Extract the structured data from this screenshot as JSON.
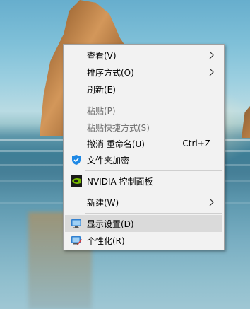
{
  "context_menu": {
    "items": [
      {
        "label": "查看(V)"
      },
      {
        "label": "排序方式(O)"
      },
      {
        "label": "刷新(E)"
      },
      {
        "label": "粘贴(P)"
      },
      {
        "label": "粘贴快捷方式(S)"
      },
      {
        "label": "撤消 重命名(U)",
        "shortcut": "Ctrl+Z"
      },
      {
        "label": "文件夹加密"
      },
      {
        "label": "NVIDIA 控制面板"
      },
      {
        "label": "新建(W)"
      },
      {
        "label": "显示设置(D)"
      },
      {
        "label": "个性化(R)"
      }
    ]
  },
  "colors": {
    "menu_background": "#f2f2f2",
    "highlight": "#dadada",
    "disabled_text": "#6d6d6d",
    "nvidia_green": "#76b900"
  }
}
